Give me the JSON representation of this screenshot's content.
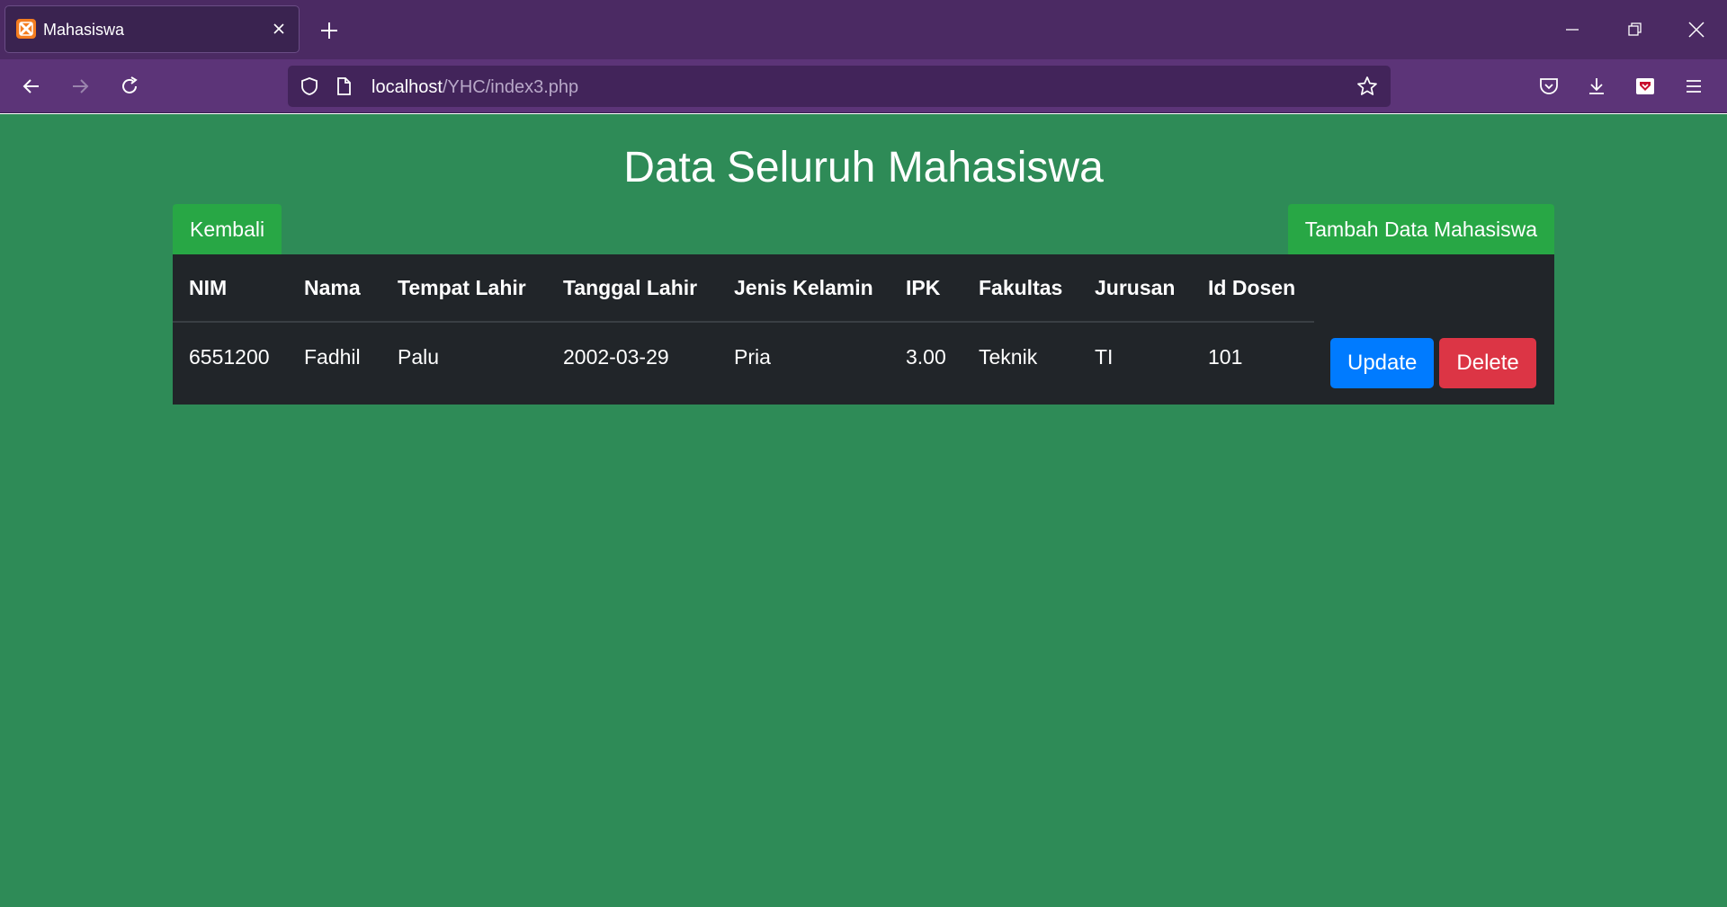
{
  "browser": {
    "tab": {
      "title": "Mahasiswa"
    },
    "url": {
      "host": "localhost",
      "path": "/YHC/index3.php"
    }
  },
  "page": {
    "title": "Data Seluruh Mahasiswa",
    "back_button": "Kembali",
    "add_button": "Tambah Data Mahasiswa",
    "background_color": "#2e8b57"
  },
  "table": {
    "headers": [
      "NIM",
      "Nama",
      "Tempat Lahir",
      "Tanggal Lahir",
      "Jenis Kelamin",
      "IPK",
      "Fakultas",
      "Jurusan",
      "Id Dosen"
    ],
    "rows": [
      {
        "cells": [
          "6551200",
          "Fadhil",
          "Palu",
          "2002-03-29",
          "Pria",
          "3.00",
          "Teknik",
          "TI",
          "101"
        ],
        "update_label": "Update",
        "delete_label": "Delete"
      }
    ]
  }
}
